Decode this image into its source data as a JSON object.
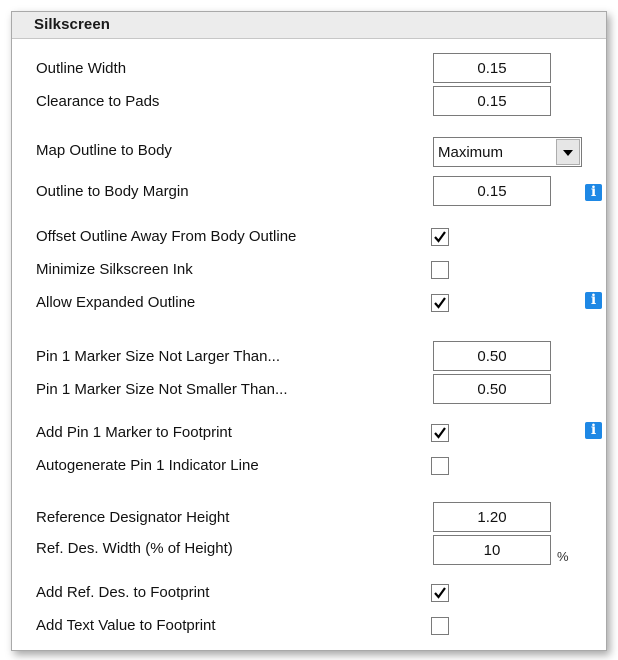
{
  "section": {
    "title": "Silkscreen"
  },
  "rows": {
    "outline_width": {
      "label": "Outline Width",
      "value": "0.15"
    },
    "clearance_to_pads": {
      "label": "Clearance to Pads",
      "value": "0.15"
    },
    "map_outline_to_body": {
      "label": "Map Outline to Body",
      "selected": "Maximum"
    },
    "outline_to_body_margin": {
      "label": "Outline to Body Margin",
      "value": "0.15"
    },
    "offset_outline_away": {
      "label": "Offset Outline Away From Body Outline",
      "checked": true
    },
    "minimize_silkscreen_ink": {
      "label": "Minimize Silkscreen Ink",
      "checked": false
    },
    "allow_expanded_outline": {
      "label": "Allow Expanded Outline",
      "checked": true
    },
    "pin1_marker_not_larger": {
      "label": "Pin 1 Marker Size Not Larger Than...",
      "value": "0.50"
    },
    "pin1_marker_not_smaller": {
      "label": "Pin 1 Marker Size Not Smaller Than...",
      "value": "0.50"
    },
    "add_pin1_marker": {
      "label": "Add Pin 1 Marker to Footprint",
      "checked": true
    },
    "autogenerate_pin1_line": {
      "label": "Autogenerate Pin 1 Indicator Line",
      "checked": false
    },
    "refdes_height": {
      "label": "Reference Designator Height",
      "value": "1.20"
    },
    "refdes_width": {
      "label": "Ref. Des. Width (% of Height)",
      "value": "10",
      "unit": "%"
    },
    "add_refdes": {
      "label": "Add Ref. Des. to Footprint",
      "checked": true
    },
    "add_text_value": {
      "label": "Add Text Value to Footprint",
      "checked": false
    }
  },
  "icons": {
    "info": "info-icon",
    "dropdown": "chevron-down-icon",
    "check": "checkmark-icon"
  },
  "colors": {
    "info_icon": "#1e88e5",
    "header_bg": "#ececec"
  }
}
